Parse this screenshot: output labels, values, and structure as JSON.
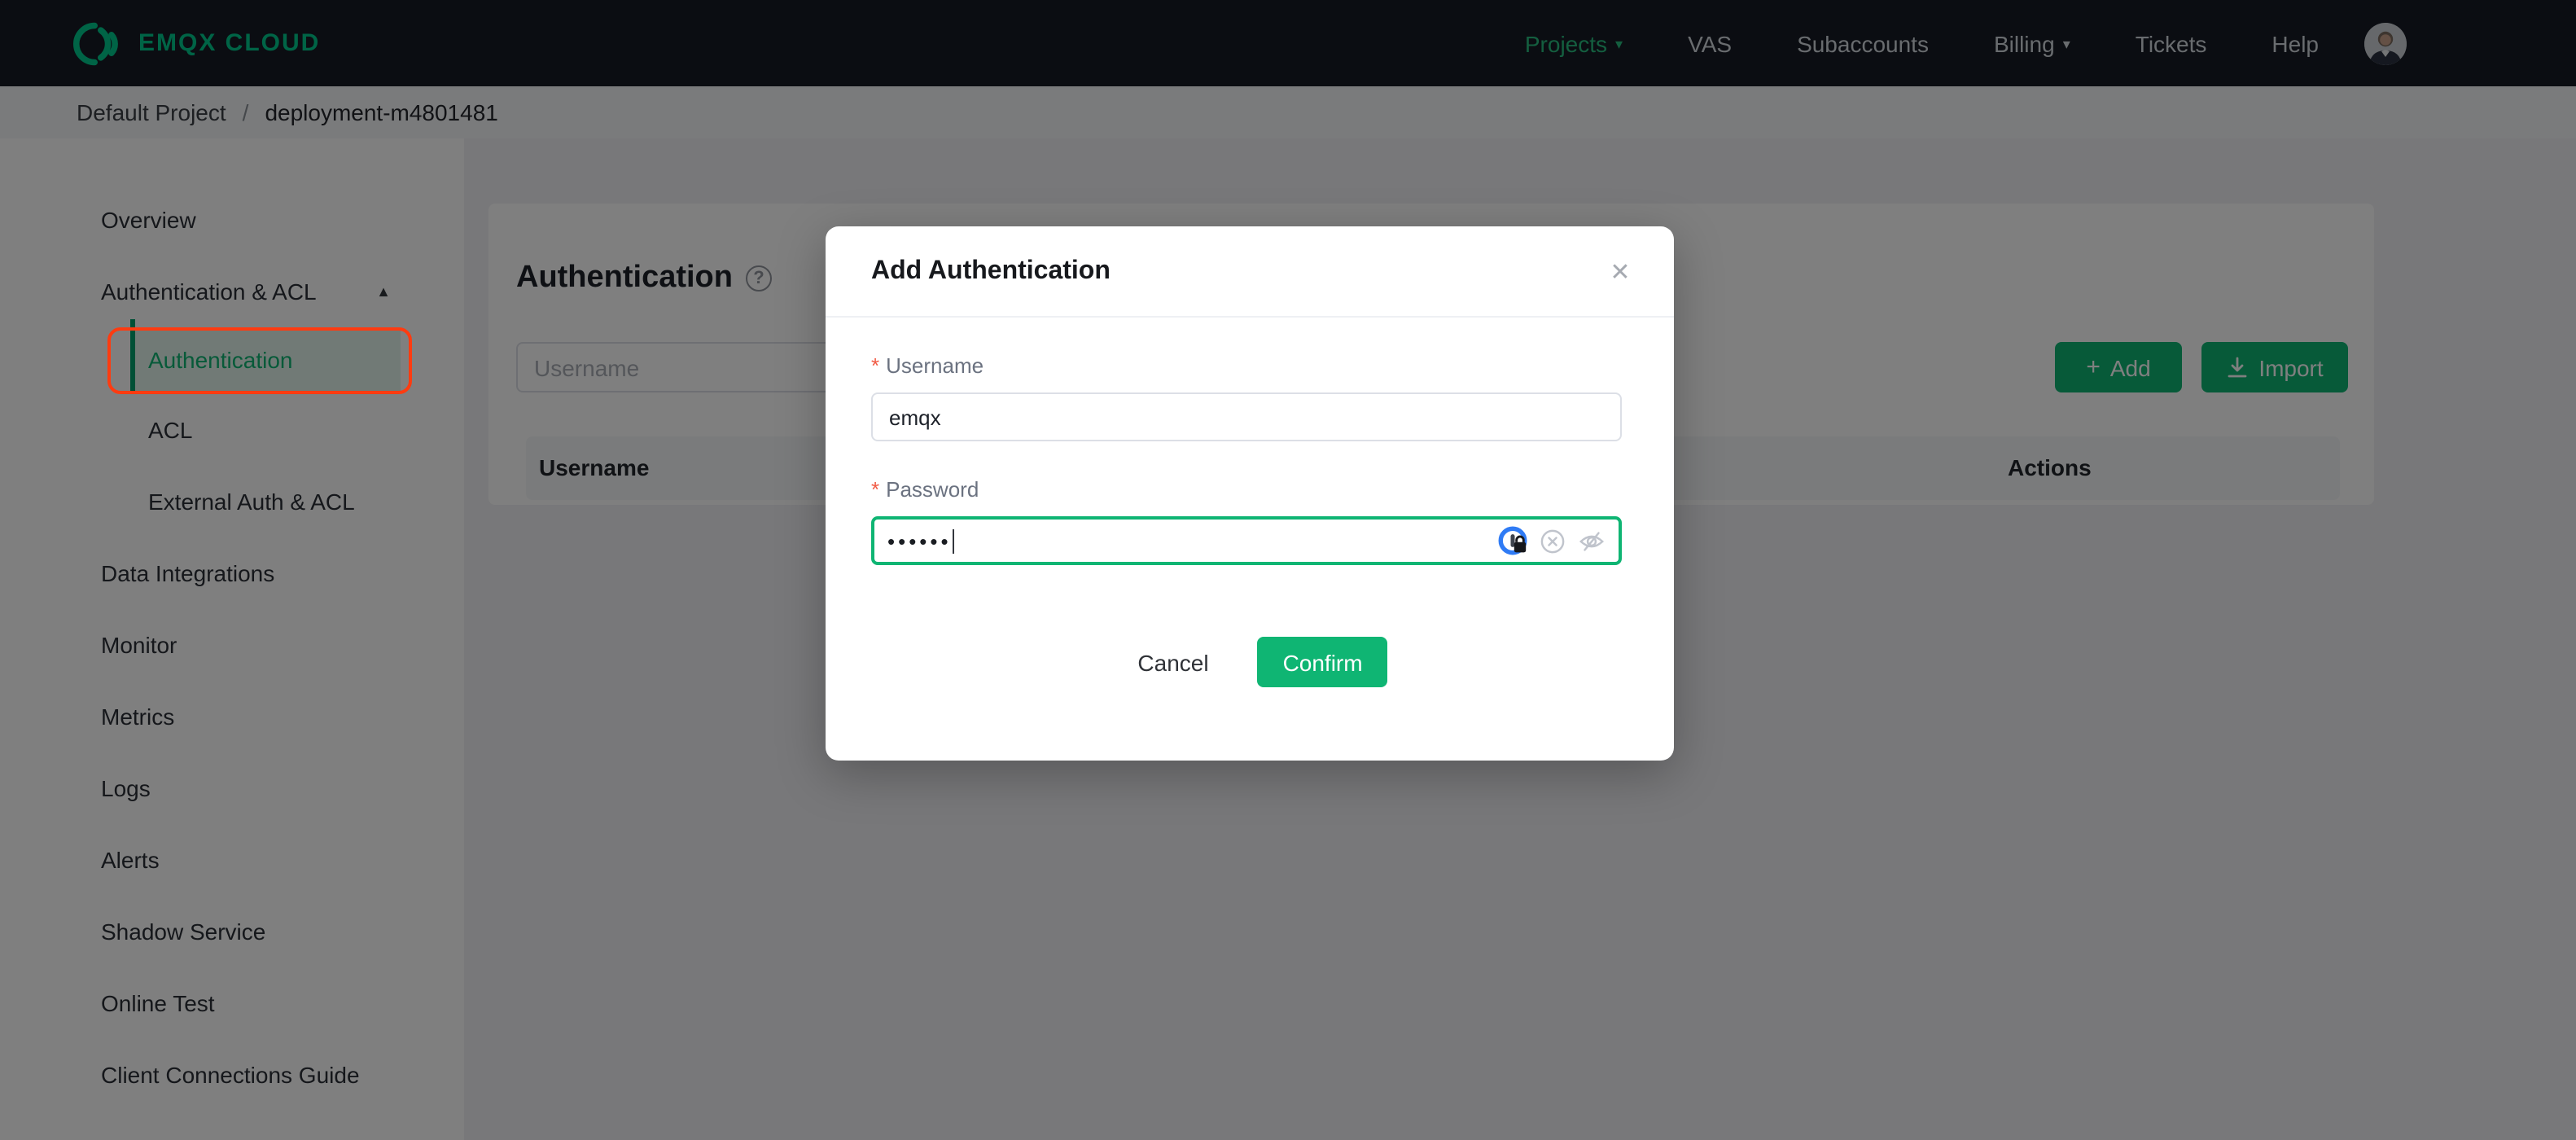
{
  "colors": {
    "primary_green": "#0fb573",
    "logo_green": "#00c98c",
    "navbar_bg": "#161b24",
    "annotation_red": "#fe3b10",
    "focus_border": "#0fb573",
    "required_red": "#f15b45"
  },
  "navbar": {
    "logo_text": "EMQX CLOUD",
    "caret_down": "▾",
    "items": [
      {
        "label": "Projects",
        "active": true,
        "has_caret": true
      },
      {
        "label": "VAS"
      },
      {
        "label": "Subaccounts"
      },
      {
        "label": "Billing",
        "has_caret": true
      },
      {
        "label": "Tickets"
      },
      {
        "label": "Help"
      }
    ]
  },
  "breadcrumb": {
    "project": "Default Project",
    "separator": "/",
    "deployment": "deployment-m4801481"
  },
  "sidebar": {
    "caret_up": "▲",
    "items": [
      {
        "label": "Overview"
      },
      {
        "label": "Authentication & ACL",
        "expanded": true
      },
      {
        "label": "Authentication",
        "active": true,
        "annotated": true
      },
      {
        "label": "ACL"
      },
      {
        "label": "External Auth & ACL"
      },
      {
        "label": "Data Integrations"
      },
      {
        "label": "Monitor"
      },
      {
        "label": "Metrics"
      },
      {
        "label": "Logs"
      },
      {
        "label": "Alerts"
      },
      {
        "label": "Shadow Service"
      },
      {
        "label": "Online Test"
      },
      {
        "label": "Client Connections Guide"
      }
    ]
  },
  "main": {
    "title": "Authentication",
    "help_icon": "?",
    "search_placeholder": "Username",
    "add_icon": "+",
    "add_label": "Add",
    "import_label": "Import",
    "table": {
      "columns": [
        "Username",
        "Actions"
      ],
      "rows": []
    }
  },
  "modal": {
    "title": "Add Authentication",
    "close_icon": "✕",
    "required_marker": "*",
    "username_label": "Username",
    "username_value": "emqx",
    "password_label": "Password",
    "password_masked": "••••••",
    "cancel_label": "Cancel",
    "confirm_label": "Confirm"
  }
}
